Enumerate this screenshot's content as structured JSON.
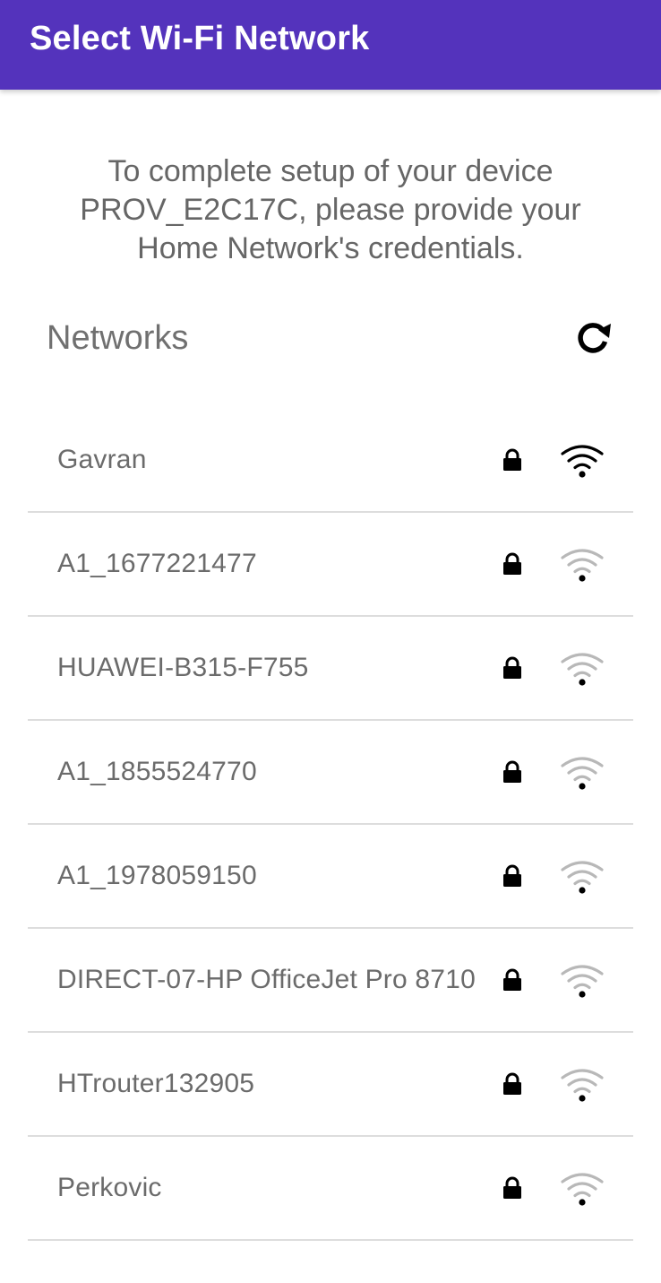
{
  "app_bar": {
    "title": "Select Wi-Fi Network",
    "color": "#5433BC"
  },
  "instructions": {
    "lines": [
      "To complete setup of your device",
      "PROV_E2C17C, please provide your",
      "Home Network's credentials."
    ]
  },
  "networks_section": {
    "label": "Networks",
    "refresh_icon": "refresh-icon"
  },
  "networks": [
    {
      "name": "Gavran",
      "secured": true,
      "signal_strength": "strong"
    },
    {
      "name": "A1_1677221477",
      "secured": true,
      "signal_strength": "weak"
    },
    {
      "name": "HUAWEI-B315-F755",
      "secured": true,
      "signal_strength": "weak"
    },
    {
      "name": "A1_1855524770",
      "secured": true,
      "signal_strength": "weak"
    },
    {
      "name": "A1_1978059150",
      "secured": true,
      "signal_strength": "weak"
    },
    {
      "name": "DIRECT-07-HP OfficeJet Pro 8710",
      "secured": true,
      "signal_strength": "weak"
    },
    {
      "name": "HTrouter132905",
      "secured": true,
      "signal_strength": "weak"
    },
    {
      "name": "Perkovic",
      "secured": true,
      "signal_strength": "weak"
    }
  ]
}
